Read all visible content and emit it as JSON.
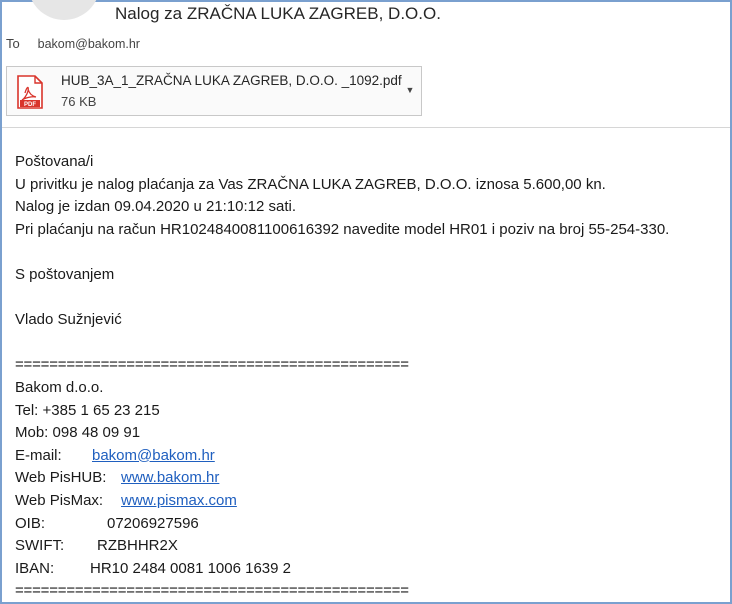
{
  "header": {
    "subject": "Nalog za ZRAČNA LUKA ZAGREB, D.O.O.",
    "to_label": "To",
    "to_value": "bakom@bakom.hr"
  },
  "attachment": {
    "icon": "pdf-icon",
    "icon_label": "PDF",
    "icon_color": "#d9342b",
    "file_name": "HUB_3A_1_ZRAČNA LUKA ZAGREB, D.O.O. _1092.pdf",
    "file_size": "76 KB"
  },
  "message": {
    "greeting": "Poštovana/i",
    "line1": "U privitku je nalog plaćanja za Vas ZRAČNA LUKA ZAGREB, D.O.O.  iznosa 5.600,00 kn.",
    "line2": "Nalog je izdan 09.04.2020 u 21:10:12 sati.",
    "line3": "Pri plaćanju na račun HR1024840081100616392 navedite model HR01 i poziv na broj 55-254-330.",
    "closing": "S poštovanjem",
    "sender": "Vlado Sužnjević"
  },
  "signature": {
    "separator": "==============================================",
    "company": "Bakom d.o.o.",
    "tel": "Tel: +385 1 65 23 215",
    "mob": "Mob:  098 48 09 91",
    "email_label": "E-mail:",
    "email_value": "bakom@bakom.hr",
    "web_pishub_label": "Web PisHUB:",
    "web_pishub_value": "www.bakom.hr",
    "web_pismax_label": "Web PisMax:",
    "web_pismax_value": "www.pismax.com",
    "oib_label": "OIB:",
    "oib_value": "07206927596",
    "swift_label": "SWIFT:",
    "swift_value": "RZBHHR2X",
    "iban_label": "IBAN:",
    "iban_value": "HR10 2484 0081 1006 1639 2"
  },
  "colors": {
    "link": "#1f5fbf",
    "frame_border": "#7aa0cf"
  }
}
